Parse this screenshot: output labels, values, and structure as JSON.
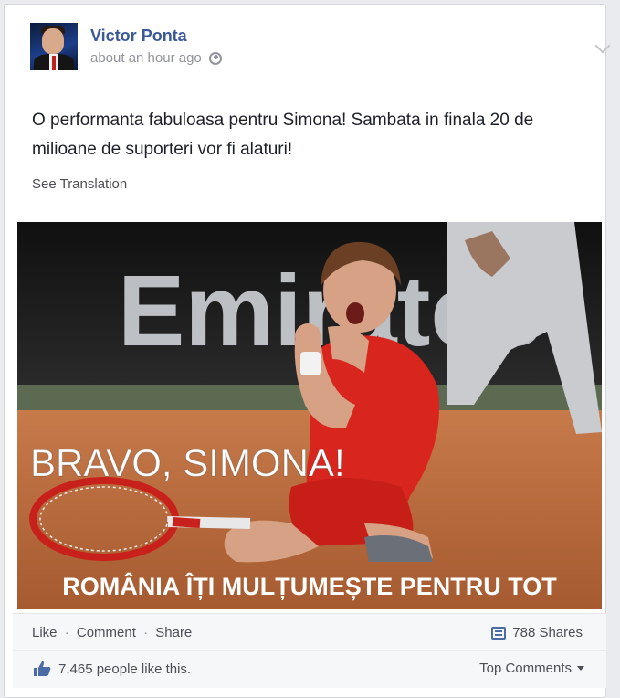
{
  "post": {
    "author": "Victor Ponta",
    "timestamp": "about an hour ago",
    "privacy_icon": "globe-icon",
    "text": "O performanta fabuloasa pentru Simona! Sambata in finala 20 de milioane de suporteri vor fi alaturi!",
    "see_translation": "See Translation"
  },
  "photo": {
    "banner_text": "Emirates",
    "headline": "BRAVO, SIMONA!",
    "caption": "ROMÂNIA ÎȚI MULȚUMEȘTE PENTRU TOT"
  },
  "actions": {
    "like": "Like",
    "comment": "Comment",
    "share": "Share",
    "separator": "·",
    "shares_count": "788 Shares"
  },
  "likes_bar": {
    "likes_text": "7,465 people like this.",
    "top_comments": "Top Comments"
  },
  "colors": {
    "link_blue": "#3b5998",
    "court_clay": "#b86a3e",
    "dress_red": "#d8261e"
  }
}
